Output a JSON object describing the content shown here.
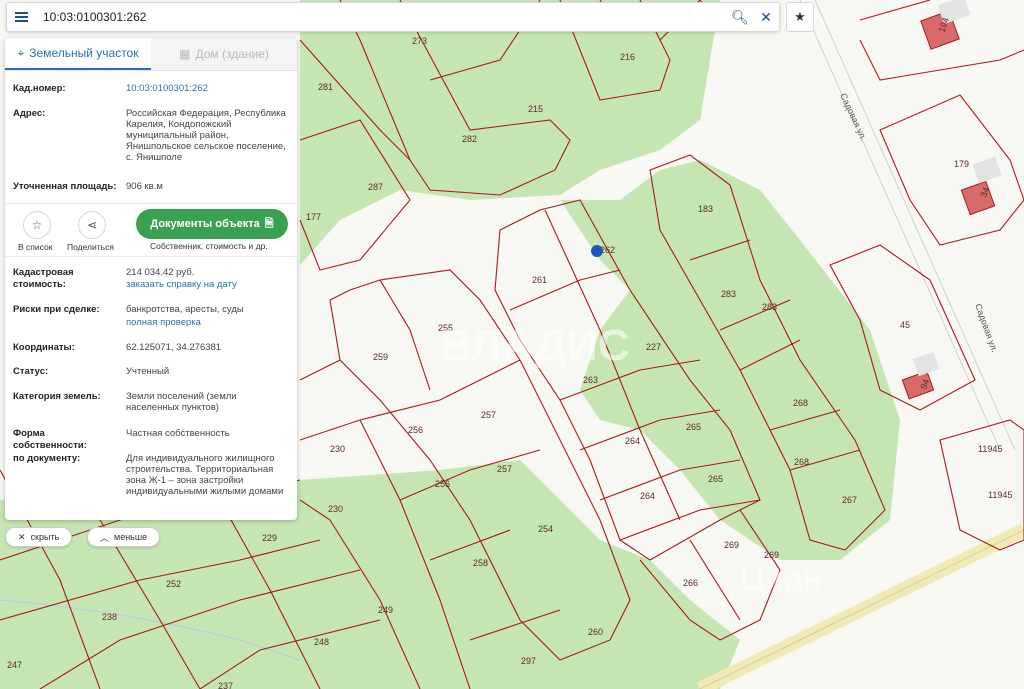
{
  "search": {
    "value": "10:03:0100301:262"
  },
  "panel": {
    "tabs": [
      {
        "label": "Земельный участок",
        "active": true
      },
      {
        "label": "Дом (здание)",
        "active": false
      }
    ],
    "cadastral_number_label": "Кад.номер:",
    "cadastral_number": "10:03:0100301:262",
    "address_label": "Адрес:",
    "address": "Российская Федерация, Республика Карелия, Кондопожский муниципальный район, Янишпольское сельское поселение, с. Янишполе",
    "area_label": "Уточненная площадь:",
    "area": "906 кв.м",
    "actions": {
      "add_to_list": "В список",
      "share": "Поделиться",
      "documents_button": "Документы объекта",
      "documents_sub": "Собственник, стоимость и др."
    },
    "value_label": "Кадастровая стоимость:",
    "value": "214 034.42 руб.",
    "value_link": "заказать справку на дату",
    "risks_label": "Риски при сделке:",
    "risks": "банкротства, аресты, суды",
    "risks_link": "полная проверка",
    "coords_label": "Координаты:",
    "coords": "62.125071, 34.276381",
    "status_label": "Статус:",
    "status": "Учтенный",
    "category_label": "Категория земель:",
    "category": "Земли поселений (земли населенных пунктов)",
    "ownership_label": "Форма собственности:",
    "ownership": "Частная собственность",
    "doc_use_label": "по документу:",
    "doc_use": "Для индивидуального жилищного строительства. Территориальная зона Ж-1 – зона застройки индивидуальными жилыми домами"
  },
  "buttons": {
    "hide": "скрыть",
    "less": "меньше"
  },
  "map": {
    "plot_labels": [
      "273",
      "216",
      "281",
      "215",
      "282",
      "287",
      "177",
      "183",
      "261",
      "262",
      "283",
      "283",
      "179",
      "255",
      "259",
      "227",
      "263",
      "268",
      "45",
      "256",
      "257",
      "264",
      "265",
      "230",
      "268",
      "264",
      "265",
      "267",
      "11945",
      "11945",
      "256",
      "257",
      "230",
      "254",
      "269",
      "269",
      "229",
      "252",
      "258",
      "266",
      "238",
      "249",
      "248",
      "260",
      "297",
      "247",
      "237"
    ],
    "building_labels": [
      "194",
      "34",
      "94"
    ],
    "streets": [
      "Садовая ул.",
      "Садовая ул."
    ],
    "watermarks": [
      "ВЛАДИС",
      "Циан"
    ],
    "colors": {
      "green": "#c5e6b3",
      "boundary": "#a61b1b",
      "marker": "#1b56b8",
      "button_green": "#3aa152",
      "link": "#2a6fb5"
    }
  }
}
